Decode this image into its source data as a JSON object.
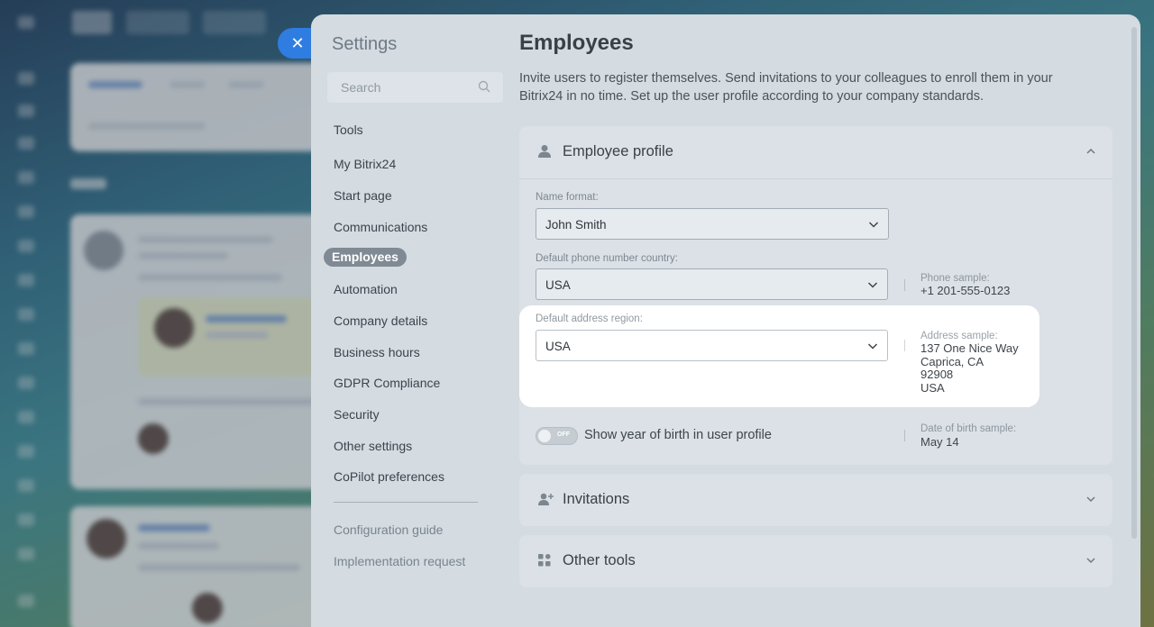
{
  "settings": {
    "title": "Settings",
    "search_placeholder": "Search",
    "nav": [
      {
        "label": "Tools",
        "active": false
      },
      {
        "label": "My Bitrix24",
        "active": false
      },
      {
        "label": "Start page",
        "active": false
      },
      {
        "label": "Communications",
        "active": false
      },
      {
        "label": "Employees",
        "active": true
      },
      {
        "label": "Automation",
        "active": false
      },
      {
        "label": "Company details",
        "active": false
      },
      {
        "label": "Business hours",
        "active": false
      },
      {
        "label": "GDPR Compliance",
        "active": false
      },
      {
        "label": "Security",
        "active": false
      },
      {
        "label": "Other settings",
        "active": false
      },
      {
        "label": "CoPilot preferences",
        "active": false
      }
    ],
    "footer_links": [
      {
        "label": "Configuration guide"
      },
      {
        "label": "Implementation request"
      }
    ]
  },
  "close_icon": "close-icon",
  "main": {
    "title": "Employees",
    "description": "Invite users to register themselves. Send invitations to your colleagues to enroll them in your Bitrix24 in no time. Set up the user profile according to your company standards.",
    "employee_profile": {
      "title": "Employee profile",
      "icon": "user-icon",
      "expanded": true,
      "name_format": {
        "label": "Name format:",
        "value": "John Smith"
      },
      "phone_country": {
        "label": "Default phone number country:",
        "value": "USA",
        "sample_label": "Phone sample:",
        "sample_value": "+1 201-555-0123"
      },
      "address_region": {
        "label": "Default address region:",
        "value": "USA",
        "sample_label": "Address sample:",
        "sample_lines": [
          "137 One Nice Way",
          "Caprica, CA",
          "92908",
          "USA"
        ]
      },
      "birth_year": {
        "toggle_state": "OFF",
        "label": "Show year of birth in user profile",
        "sample_label": "Date of birth sample:",
        "sample_value": "May 14"
      }
    },
    "invitations": {
      "title": "Invitations",
      "icon": "add-user-icon",
      "expanded": false
    },
    "other_tools": {
      "title": "Other tools",
      "icon": "grid-icon",
      "expanded": false
    }
  },
  "colors": {
    "accent": "#2f7de1",
    "active_nav_bg": "#808a94",
    "panel_bg": "#d4dbe1",
    "highlight_bg": "#ffffff"
  }
}
